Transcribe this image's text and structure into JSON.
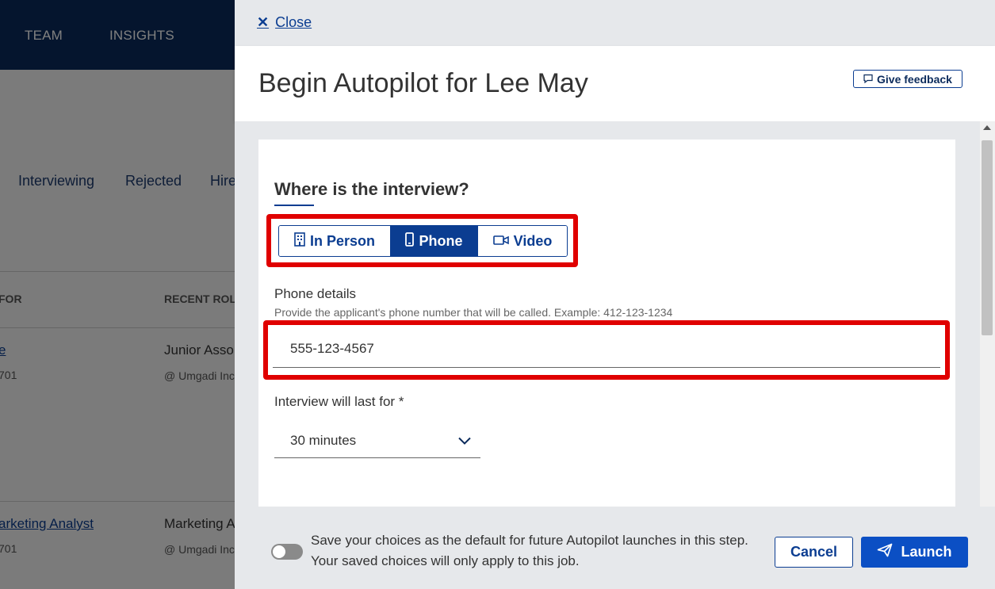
{
  "background": {
    "nav_items": [
      "TEAM",
      "INSIGHTS"
    ],
    "tabs": [
      "Interviewing",
      "Rejected",
      "Hire"
    ],
    "columns": [
      "FOR",
      "RECENT ROL"
    ],
    "rows": [
      {
        "name": "e",
        "sub": "701",
        "role": "Junior Asso",
        "company": "@ Umgadi Inc"
      },
      {
        "name": "arketing Analyst",
        "sub": "701",
        "role": "Marketing A",
        "company": "@ Umgadi Inc"
      }
    ]
  },
  "drawer": {
    "close_label": "Close",
    "title": "Begin Autopilot for Lee May",
    "feedback_label": "Give feedback",
    "location": {
      "title": "Where is the interview?",
      "options": [
        {
          "label": "In Person",
          "icon": "building-icon",
          "selected": false
        },
        {
          "label": "Phone",
          "icon": "phone-icon",
          "selected": true
        },
        {
          "label": "Video",
          "icon": "video-camera-icon",
          "selected": false
        }
      ]
    },
    "phone": {
      "label": "Phone details",
      "help": "Provide the applicant's phone number that will be called. Example: 412-123-1234",
      "value": "555-123-4567"
    },
    "duration": {
      "label": "Interview will last for *",
      "value": "30 minutes"
    },
    "footer": {
      "save_default_text": "Save your choices as the default for future Autopilot launches in this step. Your saved choices will only apply to this job.",
      "toggle_on": false,
      "cancel_label": "Cancel",
      "launch_label": "Launch"
    }
  },
  "colors": {
    "primary": "#0b3d91",
    "launch": "#0b4fc4",
    "nav": "#0b2b5c",
    "highlight": "#e00000"
  }
}
